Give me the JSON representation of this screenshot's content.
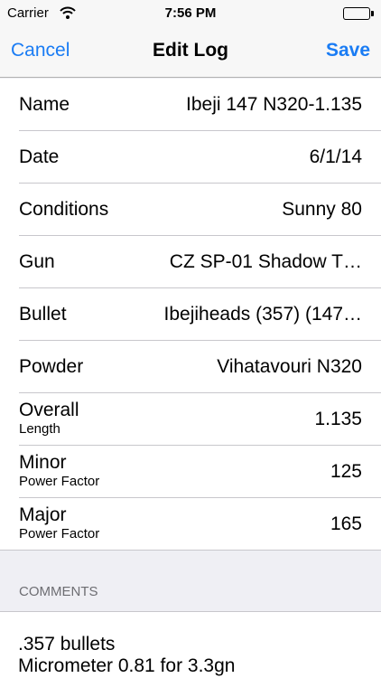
{
  "status": {
    "carrier": "Carrier",
    "time": "7:56 PM"
  },
  "nav": {
    "cancel": "Cancel",
    "title": "Edit Log",
    "save": "Save",
    "accent_color": "#1a7cf4"
  },
  "fields": [
    {
      "label": "Name",
      "value": "Ibeji 147 N320-1.135"
    },
    {
      "label": "Date",
      "value": "6/1/14"
    },
    {
      "label": "Conditions",
      "value": "Sunny 80"
    },
    {
      "label": "Gun",
      "value": "CZ SP-01 Shadow T…"
    },
    {
      "label": "Bullet",
      "value": "Ibejiheads (357) (147…"
    },
    {
      "label": "Powder",
      "value": "Vihatavouri N320"
    },
    {
      "label": "Overall",
      "sublabel": "Length",
      "value": "1.135"
    },
    {
      "label": "Minor",
      "sublabel": "Power Factor",
      "value": "125"
    },
    {
      "label": "Major",
      "sublabel": "Power Factor",
      "value": "165"
    }
  ],
  "comments": {
    "header": "COMMENTS",
    "lines": [
      ".357 bullets",
      "Micrometer 0.81 for 3.3gn"
    ]
  }
}
